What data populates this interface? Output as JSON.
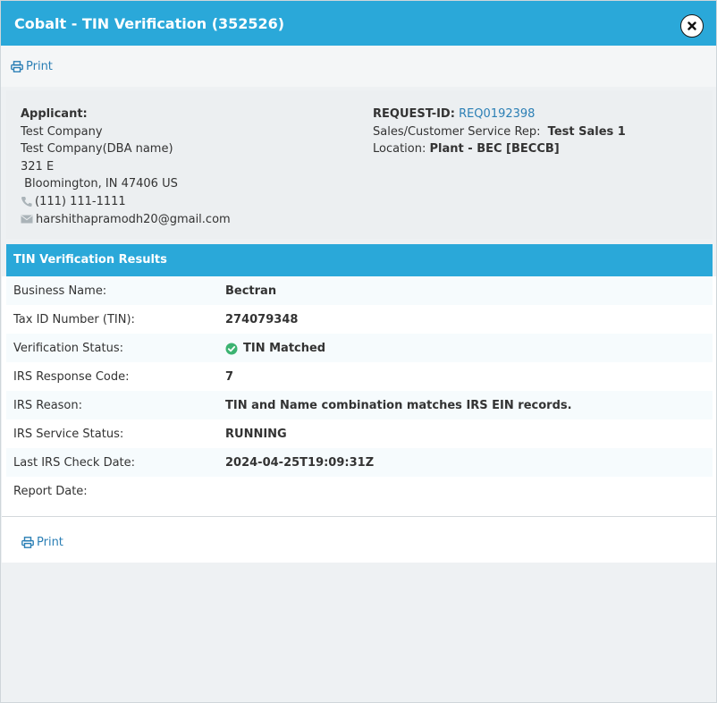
{
  "window": {
    "title": "Cobalt - TIN Verification (352526)"
  },
  "toolbar": {
    "print_label": "Print"
  },
  "applicant": {
    "label": "Applicant:",
    "name": "Test Company",
    "dba": "Test Company(DBA name)",
    "address1": "321 E",
    "address2": " Bloomington, IN 47406 US",
    "phone": "(111) 111-1111",
    "email": "harshithapramodh20@gmail.com"
  },
  "request": {
    "id_label": "REQUEST-ID:",
    "id_value": "REQ0192398",
    "rep_label": "Sales/Customer Service Rep:",
    "rep_value": "Test Sales 1",
    "location_label": "Location:",
    "location_value": "Plant - BEC [BECCB]"
  },
  "results": {
    "header": "TIN Verification Results",
    "rows": [
      {
        "label": "Business Name:",
        "value": "Bectran"
      },
      {
        "label": "Tax ID Number (TIN):",
        "value": "274079348"
      },
      {
        "label": "Verification Status:",
        "value": "TIN Matched",
        "status_color": "#3cb371"
      },
      {
        "label": "IRS Response Code:",
        "value": "7"
      },
      {
        "label": "IRS Reason:",
        "value": "TIN and Name combination matches IRS EIN records."
      },
      {
        "label": "IRS Service Status:",
        "value": "RUNNING"
      },
      {
        "label": "Last IRS Check Date:",
        "value": "2024-04-25T19:09:31Z"
      },
      {
        "label": "Report Date:",
        "value": ""
      }
    ]
  },
  "footer": {
    "print_label": "Print"
  },
  "colors": {
    "accent": "#2aa8d9",
    "link": "#2b7fb5",
    "success": "#3cb371"
  },
  "icons": [
    "close-icon",
    "printer-icon",
    "phone-icon",
    "envelope-icon",
    "check-circle-icon"
  ]
}
